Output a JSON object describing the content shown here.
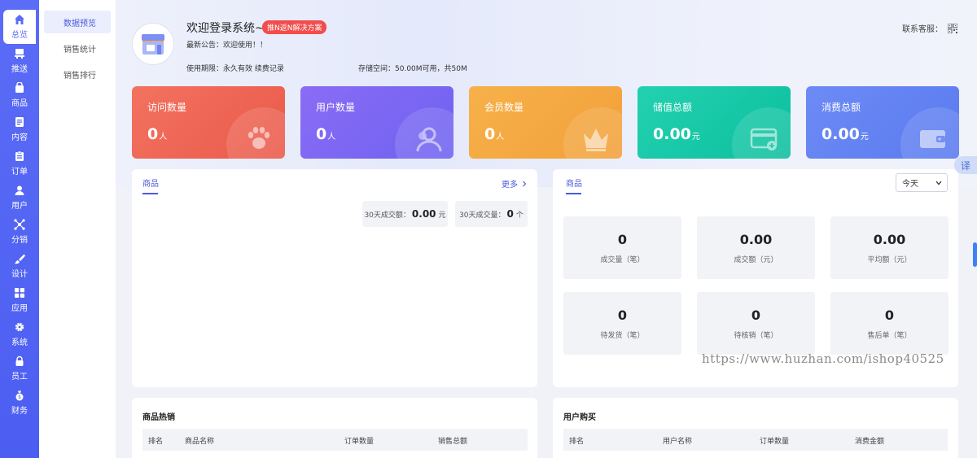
{
  "nav": {
    "items": [
      {
        "label": "总览",
        "icon": "home-icon",
        "active": true
      },
      {
        "label": "推送",
        "icon": "push-icon"
      },
      {
        "label": "商品",
        "icon": "bag-icon"
      },
      {
        "label": "内容",
        "icon": "document-icon"
      },
      {
        "label": "订单",
        "icon": "clipboard-icon"
      },
      {
        "label": "用户",
        "icon": "user-icon"
      },
      {
        "label": "分销",
        "icon": "network-icon"
      },
      {
        "label": "设计",
        "icon": "brush-icon"
      },
      {
        "label": "应用",
        "icon": "grid-icon"
      },
      {
        "label": "系统",
        "icon": "gear-icon"
      },
      {
        "label": "员工",
        "icon": "lock-icon"
      },
      {
        "label": "财务",
        "icon": "money-bag-icon"
      }
    ]
  },
  "submenu": {
    "items": [
      {
        "label": "数据预览",
        "active": true
      },
      {
        "label": "销售统计"
      },
      {
        "label": "销售排行"
      }
    ]
  },
  "header": {
    "welcome": "欢迎登录系统~",
    "badge": "推N返N解决方案",
    "notice": "最新公告：欢迎使用！！",
    "validity": "使用期限：永久有效  续费记录",
    "storage": "存储空间：50.00M可用，共50M",
    "contact_label": "联系客服："
  },
  "cards": [
    {
      "label": "访问数量",
      "value": "0",
      "unit": "人",
      "color_from": "#f3725f",
      "color_to": "#ea5a4b",
      "icon": "paw-icon"
    },
    {
      "label": "用户数量",
      "value": "0",
      "unit": "人",
      "color_from": "#8a6cf5",
      "color_to": "#6e62f0",
      "icon": "users-icon"
    },
    {
      "label": "会员数量",
      "value": "0",
      "unit": "人",
      "color_from": "#f7b14a",
      "color_to": "#f2a03a",
      "icon": "crown-icon"
    },
    {
      "label": "储值总额",
      "value": "0.00",
      "unit": "元",
      "color_from": "#22d1b0",
      "color_to": "#0dbf9f",
      "icon": "card-icon"
    },
    {
      "label": "消费总额",
      "value": "0.00",
      "unit": "元",
      "color_from": "#6d8bf5",
      "color_to": "#5a7bf0",
      "icon": "wallet-icon"
    }
  ],
  "goods_panel": {
    "tab": "商品",
    "more": "更多",
    "amount_label": "30天成交额：",
    "amount_value": "0.00",
    "amount_unit": "元",
    "volume_label": "30天成交量：",
    "volume_value": "0",
    "volume_unit": "个"
  },
  "order_panel": {
    "tab": "商品",
    "range": "今天",
    "stats": [
      {
        "value": "0",
        "caption": "成交量（笔）"
      },
      {
        "value": "0.00",
        "caption": "成交额（元）"
      },
      {
        "value": "0.00",
        "caption": "平均额（元）"
      },
      {
        "value": "0",
        "caption": "待发货（笔）"
      },
      {
        "value": "0",
        "caption": "待核销（笔）"
      },
      {
        "value": "0",
        "caption": "售后单（笔）"
      }
    ]
  },
  "hot_goods": {
    "title": "商品热销",
    "columns": [
      "排名",
      "商品名称",
      "订单数量",
      "销售总额"
    ]
  },
  "user_purchase": {
    "title": "用户购买",
    "columns": [
      "排名",
      "用户名称",
      "订单数量",
      "消费金额"
    ]
  },
  "watermark": "https://www.huzhan.com/ishop40525",
  "translate": "译"
}
